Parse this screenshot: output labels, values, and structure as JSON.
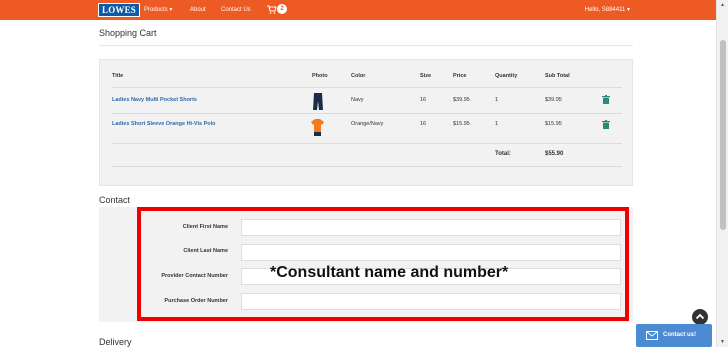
{
  "nav": {
    "logo": "LOWES",
    "products": "Products ▾",
    "about": "About",
    "contact": "Contact Us",
    "cart_count": "2",
    "user": "Hello, S884411 ▾",
    "brand_color": "#ee5a24"
  },
  "cart": {
    "heading": "Shopping Cart",
    "columns": [
      "Title",
      "Photo",
      "Color",
      "Size",
      "Price",
      "Quantity",
      "Sub Total"
    ],
    "rows": [
      {
        "title": "Ladies Navy Multi Pocket Shorts",
        "color": "Navy",
        "size": "16",
        "price": "$39.95",
        "quantity": "1",
        "subtotal": "$39.95",
        "photo_icon": "navy-shorts-icon"
      },
      {
        "title": "Ladies Short Sleeve Orange Hi-Vis Polo",
        "color": "Orange/Navy",
        "size": "16",
        "price": "$15.95",
        "quantity": "1",
        "subtotal": "$15.95",
        "photo_icon": "orange-polo-icon"
      }
    ],
    "total_label": "Total:",
    "total_value": "$55.90"
  },
  "contact": {
    "heading": "Contact",
    "fields": [
      {
        "label": "Client First Name",
        "value": ""
      },
      {
        "label": "Client Last Name",
        "value": ""
      },
      {
        "label": "Provider Contact Number",
        "value": ""
      },
      {
        "label": "Purchase Order Number",
        "value": ""
      }
    ],
    "annotation": "*Consultant name and number*",
    "highlight_color": "#ee0000"
  },
  "delivery": {
    "heading": "Delivery"
  },
  "widgets": {
    "contact_us": "Contact us!"
  }
}
